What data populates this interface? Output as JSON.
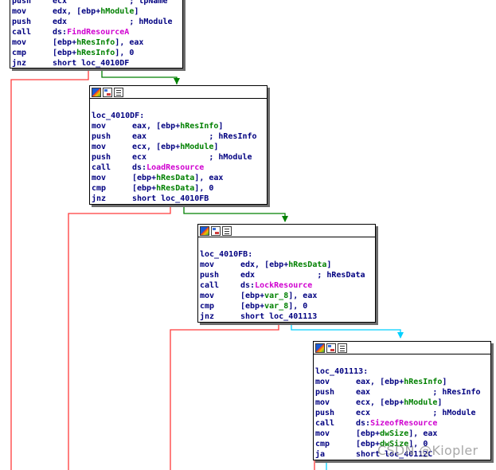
{
  "colors": {
    "edge_true": "#008000",
    "edge_false": "#ff0000",
    "edge_uncond": "#00d0ff",
    "var": "#008000",
    "api": "#d000d0",
    "text": "#000080"
  },
  "nodes": {
    "top": {
      "lines": [
        {
          "mn": "push",
          "ops": "ecx",
          "tail": "             ; lpName"
        },
        {
          "mn": "mov",
          "ops": "edx, [ebp+hModule]"
        },
        {
          "mn": "push",
          "ops": "edx",
          "tail": "             ; hModule"
        },
        {
          "mn": "call",
          "ops": "ds:FindResourceA"
        },
        {
          "mn": "mov",
          "ops": "[ebp+hResInfo], eax"
        },
        {
          "mn": "cmp",
          "ops": "[ebp+hResInfo], 0"
        },
        {
          "mn": "jnz",
          "ops": "short loc_4010DF"
        }
      ]
    },
    "n2": {
      "label": "loc_4010DF:",
      "lines": [
        {
          "mn": "mov",
          "ops": "eax, [ebp+hResInfo]"
        },
        {
          "mn": "push",
          "ops": "eax",
          "tail": "             ; hResInfo"
        },
        {
          "mn": "mov",
          "ops": "ecx, [ebp+hModule]"
        },
        {
          "mn": "push",
          "ops": "ecx",
          "tail": "             ; hModule"
        },
        {
          "mn": "call",
          "ops": "ds:LoadResource"
        },
        {
          "mn": "mov",
          "ops": "[ebp+hResData], eax"
        },
        {
          "mn": "cmp",
          "ops": "[ebp+hResData], 0"
        },
        {
          "mn": "jnz",
          "ops": "short loc_4010FB"
        }
      ]
    },
    "n3": {
      "label": "loc_4010FB:",
      "lines": [
        {
          "mn": "mov",
          "ops": "edx, [ebp+hResData]"
        },
        {
          "mn": "push",
          "ops": "edx",
          "tail": "             ; hResData"
        },
        {
          "mn": "call",
          "ops": "ds:LockResource"
        },
        {
          "mn": "mov",
          "ops": "[ebp+var_8], eax"
        },
        {
          "mn": "cmp",
          "ops": "[ebp+var_8], 0"
        },
        {
          "mn": "jnz",
          "ops": "short loc_401113"
        }
      ]
    },
    "n4": {
      "label": "loc_401113:",
      "lines": [
        {
          "mn": "mov",
          "ops": "eax, [ebp+hResInfo]"
        },
        {
          "mn": "push",
          "ops": "eax",
          "tail": "             ; hResInfo"
        },
        {
          "mn": "mov",
          "ops": "ecx, [ebp+hModule]"
        },
        {
          "mn": "push",
          "ops": "ecx",
          "tail": "             ; hModule"
        },
        {
          "mn": "call",
          "ops": "ds:SizeofResource"
        },
        {
          "mn": "mov",
          "ops": "[ebp+dwSize], eax"
        },
        {
          "mn": "cmp",
          "ops": "[ebp+dwSize], 0"
        },
        {
          "mn": "ja",
          "ops": "short loc_40112C"
        }
      ]
    }
  },
  "watermark": "CSDN @Kiopler"
}
